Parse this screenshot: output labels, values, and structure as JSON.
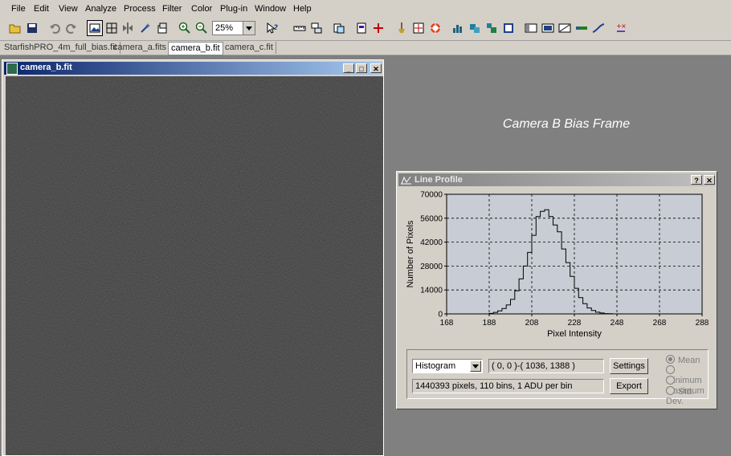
{
  "menu": [
    "File",
    "Edit",
    "View",
    "Analyze",
    "Process",
    "Filter",
    "Color",
    "Plug-in",
    "Window",
    "Help"
  ],
  "toolbar": {
    "zoom_value": "25%",
    "icons": [
      "open-icon",
      "save-icon",
      "undo-icon",
      "redo-icon",
      "select-icon",
      "crosshair-icon",
      "flip-icon",
      "wand-icon",
      "adjust-icon",
      "zoom-in-icon",
      "zoom-out-icon",
      "help-cursor-icon",
      "ruler-icon",
      "layers-icon",
      "copy-icon",
      "page-icon",
      "pin-icon",
      "cross-icon",
      "star-icon",
      "target-icon",
      "bar-chart-icon",
      "box1-icon",
      "box2-icon",
      "square-icon",
      "panel1-icon",
      "panel2-icon",
      "panel3-icon",
      "dash-icon",
      "curve-icon",
      "plusminus-icon"
    ]
  },
  "tabs": [
    "StarfishPRO_4m_full_bias.fit",
    "camera_a.fits",
    "camera_b.fit",
    "camera_c.fit"
  ],
  "active_tab": "camera_b.fit",
  "image_window": {
    "title": "camera_b.fit"
  },
  "caption": "Camera B Bias Frame",
  "line_profile": {
    "title": "Line Profile",
    "mode": "Histogram",
    "region": "( 0, 0 )-( 1036, 1388 )",
    "summary": "1440393 pixels, 110 bins, 1 ADU per bin",
    "settings_label": "Settings",
    "export_label": "Export",
    "radio_options": [
      "Mean",
      "Minimum",
      "Maximum",
      "Std. Dev."
    ],
    "radio_selected": "Mean"
  },
  "chart_data": {
    "type": "line",
    "xlabel": "Pixel Intensity",
    "ylabel": "Number of Pixels",
    "xlim": [
      168,
      288
    ],
    "ylim": [
      0,
      70000
    ],
    "xticks": [
      168,
      188,
      208,
      228,
      248,
      268,
      288
    ],
    "yticks": [
      0,
      14000,
      28000,
      42000,
      56000,
      70000
    ],
    "x": [
      186,
      188,
      190,
      192,
      194,
      196,
      198,
      200,
      202,
      204,
      206,
      208,
      210,
      212,
      214,
      216,
      218,
      220,
      222,
      224,
      226,
      228,
      230,
      232,
      234,
      236,
      238,
      240,
      242,
      244,
      246,
      248,
      250
    ],
    "y": [
      0,
      300,
      900,
      1800,
      3200,
      5200,
      8500,
      13500,
      20500,
      28000,
      36000,
      46000,
      57000,
      60000,
      61000,
      57000,
      52000,
      48000,
      38000,
      30000,
      22000,
      15000,
      9500,
      6000,
      3500,
      2000,
      1000,
      500,
      200,
      100,
      0,
      0,
      0
    ],
    "grid": true,
    "colors": {
      "background": "#c8ccd4",
      "line": "#000000"
    }
  },
  "colors": {
    "chrome": "#d4d0c8",
    "titlebar_active": "#0a246a",
    "workspace": "#808080"
  }
}
